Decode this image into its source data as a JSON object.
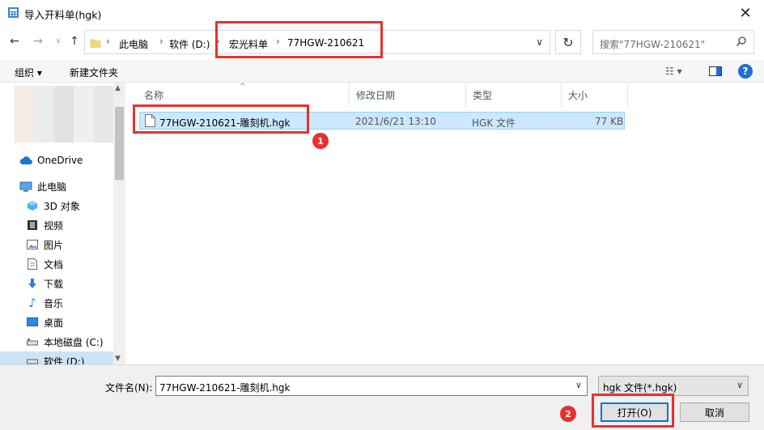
{
  "title_bar": {
    "title": "导入开料单(hgk)"
  },
  "address": {
    "crumbs": [
      "此电脑",
      "软件 (D:)",
      "宏光料单",
      "77HGW-210621"
    ],
    "search_placeholder": "搜索\"77HGW-210621\""
  },
  "toolbar": {
    "organize": "组织 ▾",
    "new_folder": "新建文件夹"
  },
  "nav": {
    "items": [
      {
        "label": "OneDrive",
        "icon": "cloud-icon"
      },
      {
        "label": "此电脑",
        "icon": "computer-icon"
      },
      {
        "label": "3D 对象",
        "icon": "3d-objects-icon"
      },
      {
        "label": "视频",
        "icon": "video-icon"
      },
      {
        "label": "图片",
        "icon": "pictures-icon"
      },
      {
        "label": "文档",
        "icon": "documents-icon"
      },
      {
        "label": "下载",
        "icon": "download-icon"
      },
      {
        "label": "音乐",
        "icon": "music-icon"
      },
      {
        "label": "桌面",
        "icon": "desktop-icon"
      },
      {
        "label": "本地磁盘 (C:)",
        "icon": "drive-icon"
      },
      {
        "label": "软件 (D:)",
        "icon": "drive-icon"
      }
    ]
  },
  "file_list": {
    "columns": [
      "名称",
      "修改日期",
      "类型",
      "大小"
    ],
    "rows": [
      {
        "name": "77HGW-210621-雕刻机.hgk",
        "modified": "2021/6/21 13:10",
        "type": "HGK 文件",
        "size": "77 KB"
      }
    ]
  },
  "bottom": {
    "filename_label": "文件名(N):",
    "filename_value": "77HGW-210621-雕刻机.hgk",
    "filetype_value": "hgk 文件(*.hgk)",
    "open_label": "打开(O)",
    "cancel_label": "取消"
  },
  "annotations": {
    "badge1": "1",
    "badge2": "2"
  },
  "colors": {
    "annotation_red": "#e8312f",
    "selection_blue": "#cce8ff",
    "accent": "#0078d7"
  }
}
